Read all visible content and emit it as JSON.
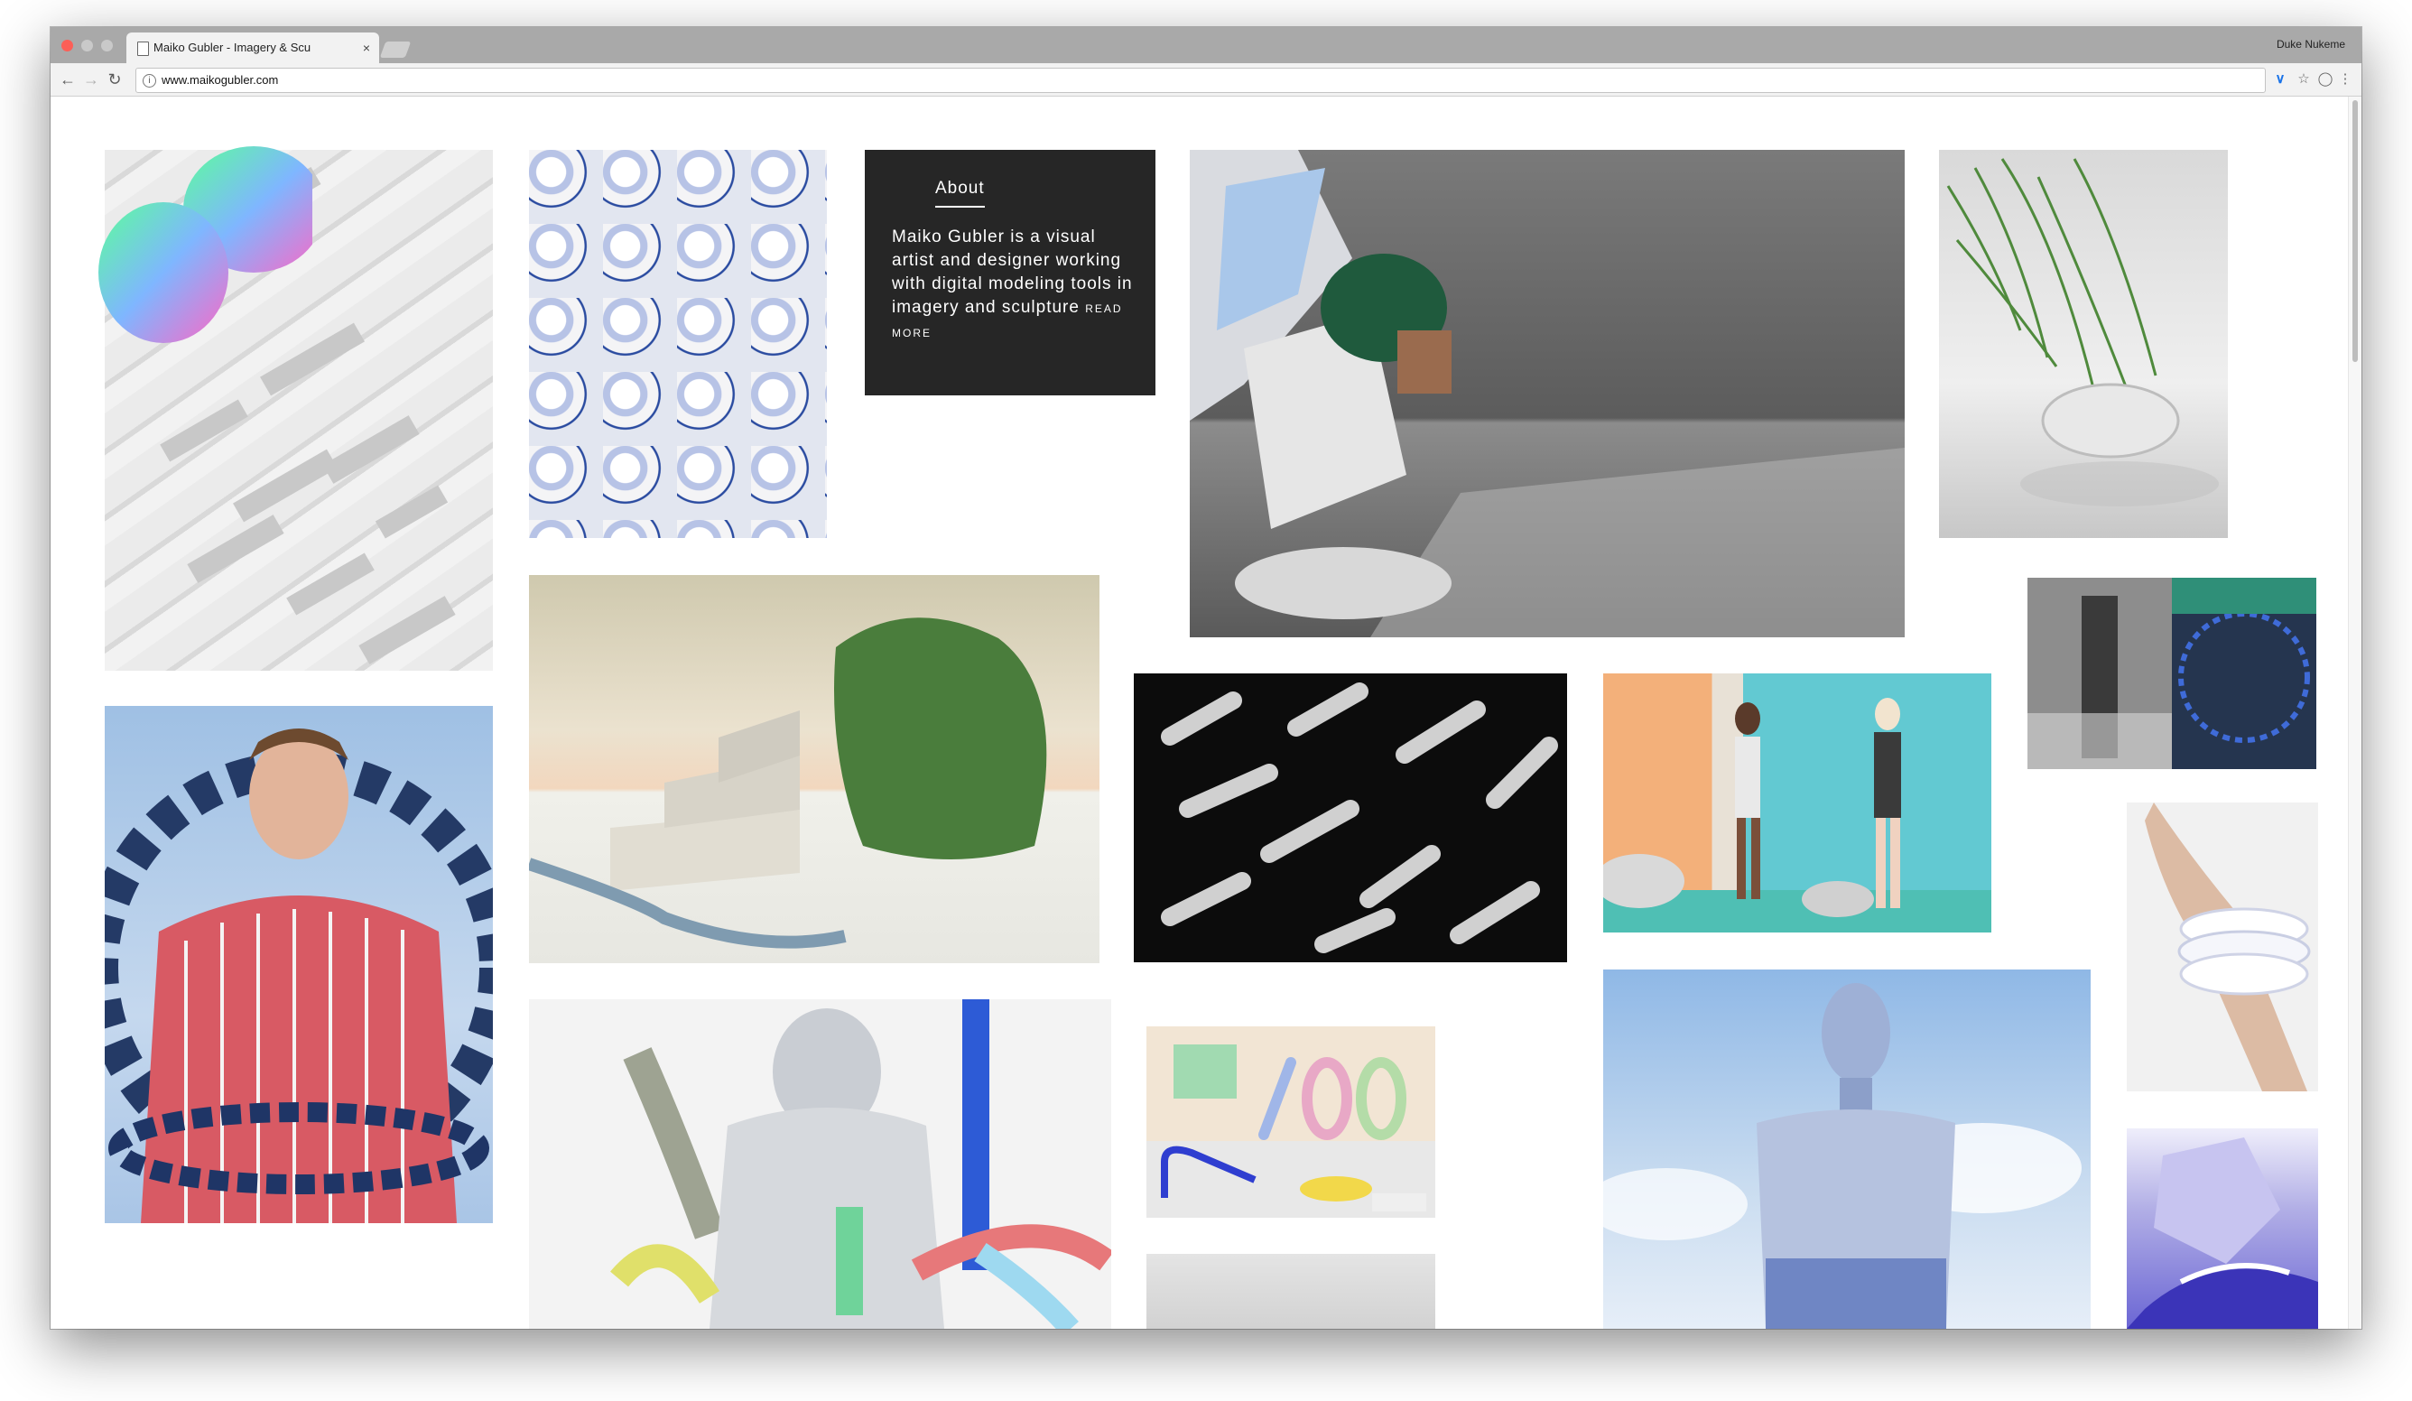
{
  "browser": {
    "tab_title": "Maiko Gubler - Imagery & Scu",
    "tab_close": "×",
    "profile_name": "Duke Nukeme",
    "url": "www.maikogubler.com",
    "info_glyph": "i"
  },
  "about": {
    "heading": "About",
    "body": "Maiko Gubler is a visual artist and designer working with digital modeling tools in imagery and sculpture",
    "read_more": "READ MORE"
  },
  "gallery": {
    "tiles": [
      {
        "name": "white-relief-texture",
        "bg": "#e6e6e6"
      },
      {
        "name": "blue-white-stones",
        "bg": "#c9d0e4"
      },
      {
        "name": "grey-room-plant",
        "bg": "#6c6c6c"
      },
      {
        "name": "grass-disc-sculpture",
        "bg": "#dcdcdc"
      },
      {
        "name": "moss-rock-stairs",
        "bg": "#cfc9b0"
      },
      {
        "name": "monochrome-collage",
        "bg": "#2c2c2c"
      },
      {
        "name": "striped-shirt-portrait",
        "bg": "#a8c2de"
      },
      {
        "name": "black-brush-strokes",
        "bg": "#0e0e0e"
      },
      {
        "name": "swimsuit-models",
        "bg": "#6fcfd6"
      },
      {
        "name": "white-bracelet-arm",
        "bg": "#efefef"
      },
      {
        "name": "chrome-figure-tubes",
        "bg": "#f2f2f2"
      },
      {
        "name": "pastel-letters",
        "bg": "#f3ece6"
      },
      {
        "name": "chrome-man-sky",
        "bg": "#a7c9ea"
      },
      {
        "name": "blue-sculpture-hands",
        "bg": "#8a86d8"
      },
      {
        "name": "grey-tile-bottom",
        "bg": "#dedede"
      }
    ]
  },
  "colors": {
    "about_bg": "#262626",
    "logo_gradient": [
      "#66ff99",
      "#7fb0ff",
      "#ff66cc"
    ]
  }
}
